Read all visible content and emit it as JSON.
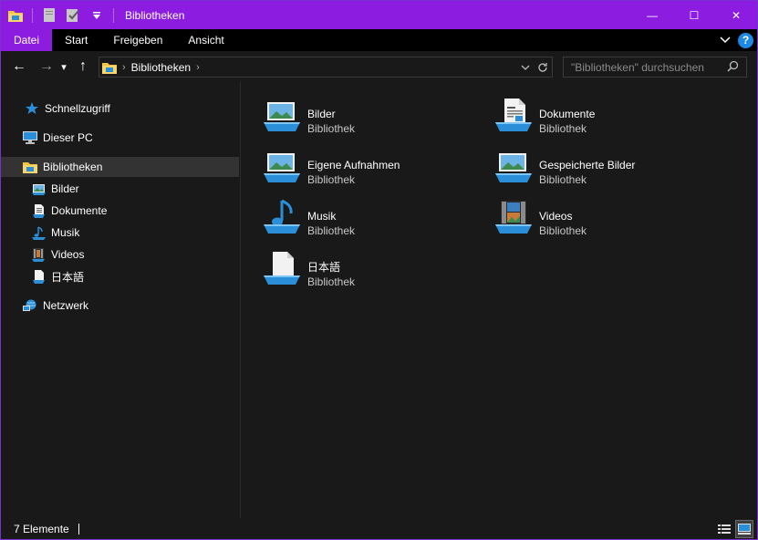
{
  "window": {
    "title": "Bibliotheken",
    "controls": {
      "minimize": "—",
      "maximize": "☐",
      "close": "✕"
    }
  },
  "ribbon": {
    "tabs": [
      "Datei",
      "Start",
      "Freigeben",
      "Ansicht"
    ]
  },
  "nav": {
    "back": "←",
    "forward": "→",
    "recent": "▾",
    "up": "↑",
    "address": "Bibliotheken",
    "address_sep": "›",
    "search_placeholder": "\"Bibliotheken\" durchsuchen"
  },
  "sidebar": {
    "items": [
      {
        "label": "Schnellzugriff",
        "icon": "star-icon"
      },
      {
        "label": "Dieser PC",
        "icon": "computer-icon"
      },
      {
        "label": "Bibliotheken",
        "icon": "library-folder-icon",
        "selected": true
      },
      {
        "label": "Bilder",
        "icon": "pictures-icon"
      },
      {
        "label": "Dokumente",
        "icon": "documents-icon"
      },
      {
        "label": "Musik",
        "icon": "music-icon"
      },
      {
        "label": "Videos",
        "icon": "videos-icon"
      },
      {
        "label": "日本語",
        "icon": "document-icon"
      },
      {
        "label": "Netzwerk",
        "icon": "network-icon"
      }
    ]
  },
  "libraries": [
    {
      "name": "Bilder",
      "type": "Bibliothek",
      "icon": "pictures-library-icon"
    },
    {
      "name": "Dokumente",
      "type": "Bibliothek",
      "icon": "documents-library-icon"
    },
    {
      "name": "Eigene Aufnahmen",
      "type": "Bibliothek",
      "icon": "pictures-library-icon"
    },
    {
      "name": "Gespeicherte Bilder",
      "type": "Bibliothek",
      "icon": "pictures-library-icon"
    },
    {
      "name": "Musik",
      "type": "Bibliothek",
      "icon": "music-library-icon"
    },
    {
      "name": "Videos",
      "type": "Bibliothek",
      "icon": "videos-library-icon"
    },
    {
      "name": "日本語",
      "type": "Bibliothek",
      "icon": "generic-library-icon"
    }
  ],
  "status": {
    "count": "7 Elemente"
  },
  "colors": {
    "accent": "#8c1de0",
    "background": "#191919",
    "help": "#1e88e5"
  }
}
